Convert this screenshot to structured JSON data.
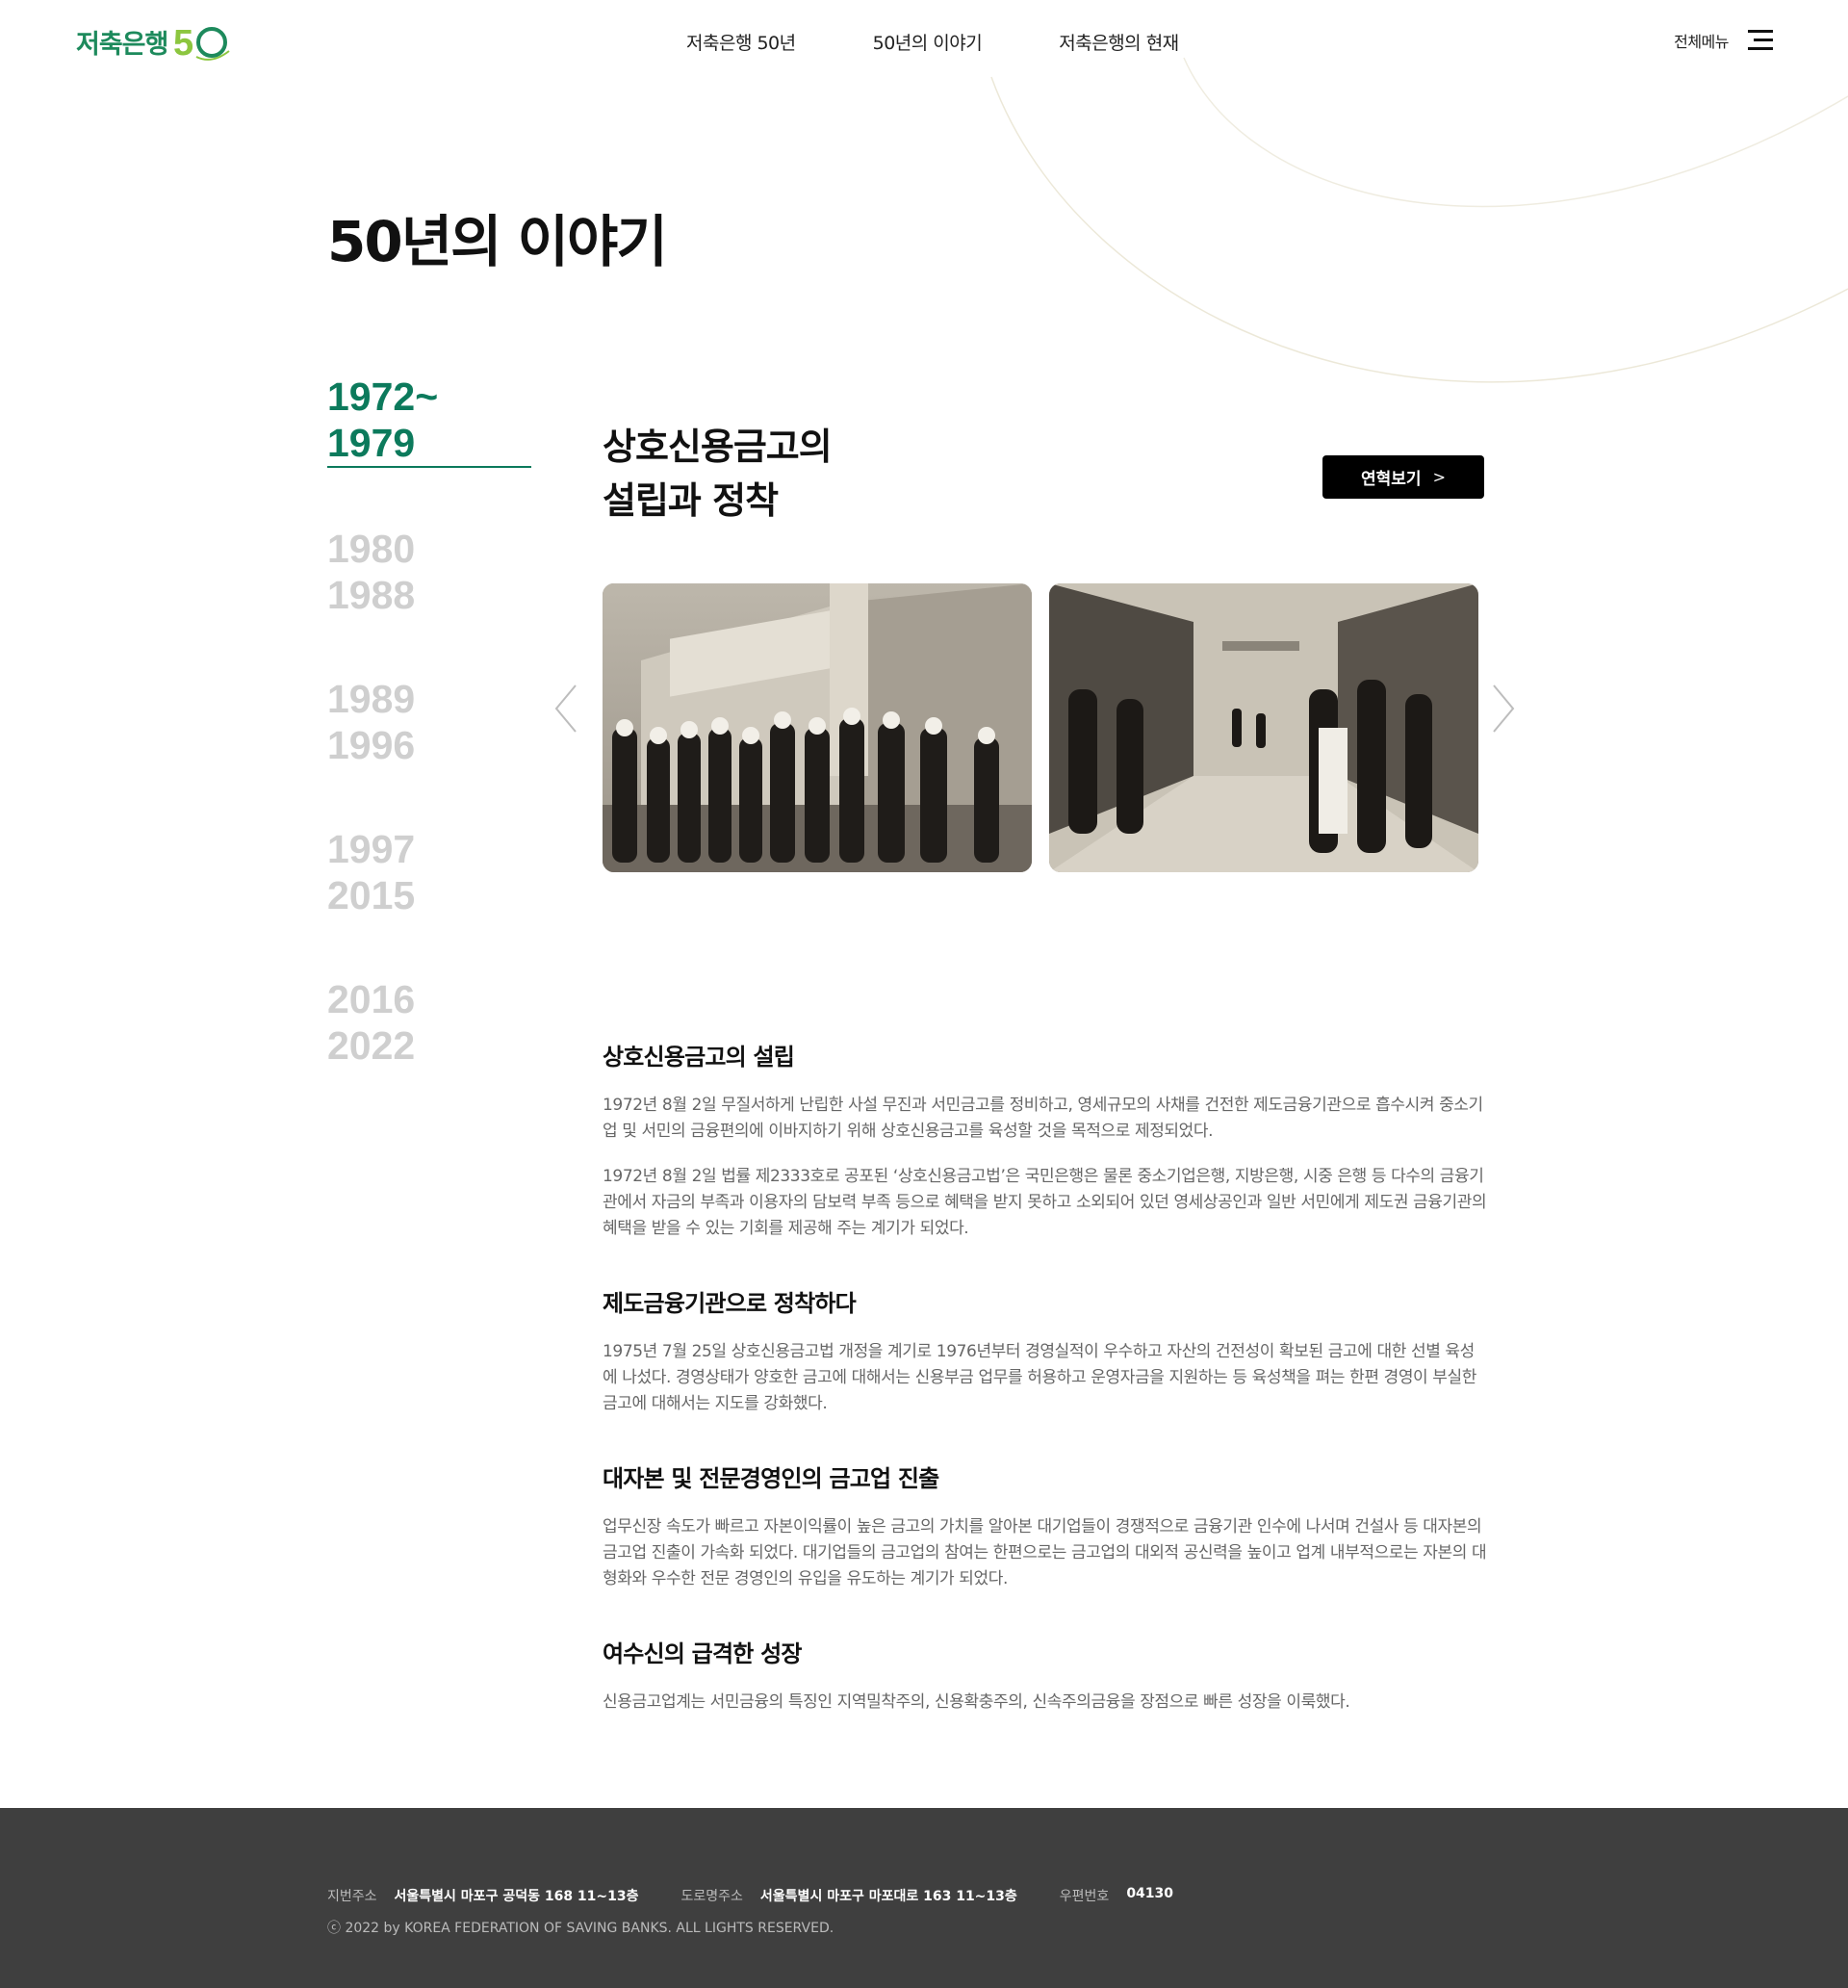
{
  "header": {
    "logo_text": "저축은행",
    "nav": [
      "저축은행 50년",
      "50년의 이야기",
      "저축은행의 현재"
    ],
    "allmenu_label": "전체메뉴"
  },
  "page_title": "50년의 이야기",
  "timeline": [
    {
      "start": "1972~",
      "end": "1979",
      "active": true
    },
    {
      "start": "1980",
      "end": "1988",
      "active": false
    },
    {
      "start": "1989",
      "end": "1996",
      "active": false
    },
    {
      "start": "1997",
      "end": "2015",
      "active": false
    },
    {
      "start": "2016",
      "end": "2022",
      "active": false
    }
  ],
  "era": {
    "title_line1": "상호신용금고의",
    "title_line2": "설립과 정착",
    "button_label": "연혁보기"
  },
  "sections": [
    {
      "heading": "상호신용금고의 설립",
      "paragraphs": [
        "1972년 8월 2일 무질서하게 난립한 사설 무진과 서민금고를 정비하고, 영세규모의 사채를 건전한 제도금융기관으로 흡수시켜 중소기업 및 서민의 금융편의에 이바지하기 위해 상호신용금고를 육성할 것을 목적으로 제정되었다.",
        "1972년 8월 2일 법률 제2333호로 공포된 ‘상호신용금고법’은 국민은행은 물론 중소기업은행, 지방은행, 시중 은행 등 다수의 금융기관에서 자금의 부족과 이용자의 담보력 부족 등으로 혜택을 받지 못하고 소외되어 있던 영세상공인과 일반 서민에게 제도권 금융기관의 혜택을 받을 수 있는 기회를 제공해 주는 계기가 되었다."
      ]
    },
    {
      "heading": "제도금융기관으로 정착하다",
      "paragraphs": [
        "1975년 7월 25일 상호신용금고법 개정을 계기로 1976년부터 경영실적이 우수하고 자산의 건전성이 확보된 금고에 대한 선별 육성에 나섰다. 경영상태가 양호한 금고에 대해서는 신용부금 업무를 허용하고 운영자금을 지원하는 등 육성책을 펴는 한편 경영이 부실한 금고에 대해서는 지도를 강화했다."
      ]
    },
    {
      "heading": "대자본 및 전문경영인의 금고업 진출",
      "paragraphs": [
        "업무신장 속도가 빠르고 자본이익률이 높은 금고의 가치를 알아본 대기업들이 경쟁적으로 금융기관 인수에 나서며 건설사 등 대자본의 금고업 진출이 가속화 되었다. 대기업들의 금고업의 참여는 한편으로는 금고업의 대외적 공신력을 높이고 업계 내부적으로는 자본의 대형화와 우수한 전문 경영인의 유입을 유도하는 계기가 되었다."
      ]
    },
    {
      "heading": "여수신의 급격한 성장",
      "paragraphs": [
        "신용금고업계는 서민금융의 특징인 지역밀착주의, 신용확충주의, 신속주의금융을 장점으로 빠른 성장을 이룩했다."
      ]
    }
  ],
  "footer": {
    "jibun_label": "지번주소",
    "jibun_value": "서울특별시 마포구 공덕동 168 11~13층",
    "road_label": "도로명주소",
    "road_value": "서울특별시 마포구 마포대로 163 11~13층",
    "zip_label": "우편번호",
    "zip_value": "04130",
    "copyright": "ⓒ 2022 by KOREA FEDERATION OF SAVING BANKS. ALL LIGHTS RESERVED."
  },
  "colors": {
    "brand_green": "#0c7a5c",
    "footer_bg": "#3f3f3f"
  },
  "icons": [
    "hamburger-menu-icon",
    "chevron-right-icon",
    "slider-prev-icon",
    "slider-next-icon"
  ]
}
